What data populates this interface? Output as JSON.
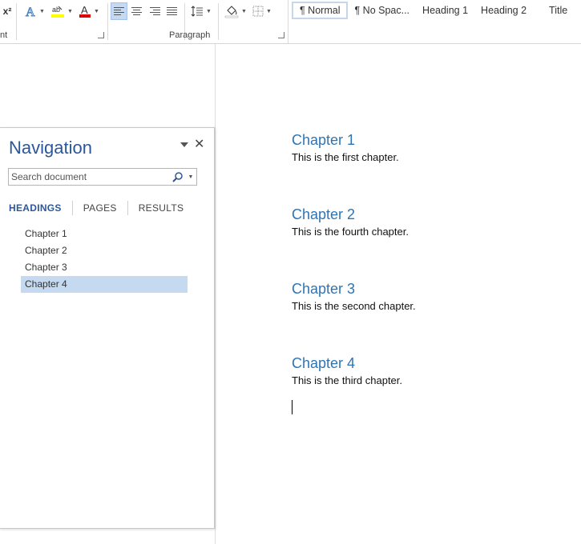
{
  "ribbon": {
    "font_group_label": "nt",
    "paragraph_group_label": "Paragraph",
    "superscript_label": "x²",
    "styles": [
      {
        "label": "¶ Normal",
        "active": true
      },
      {
        "label": "¶ No Spac...",
        "active": false
      },
      {
        "label": "Heading 1",
        "active": false
      },
      {
        "label": "Heading 2",
        "active": false
      },
      {
        "label": "Title",
        "active": false
      }
    ]
  },
  "navigation": {
    "title": "Navigation",
    "search_placeholder": "Search document",
    "tabs": [
      "HEADINGS",
      "PAGES",
      "RESULTS"
    ],
    "active_tab": "HEADINGS",
    "headings": [
      "Chapter 1",
      "Chapter 2",
      "Chapter 3",
      "Chapter 4"
    ],
    "selected_heading": "Chapter 4"
  },
  "document": {
    "chapters": [
      {
        "heading": "Chapter 1",
        "text": "This is the first chapter."
      },
      {
        "heading": "Chapter 2",
        "text": "This is the fourth chapter."
      },
      {
        "heading": "Chapter 3",
        "text": "This is the second chapter."
      },
      {
        "heading": "Chapter 4",
        "text": "This is the third chapter."
      }
    ]
  },
  "colors": {
    "accent": "#2b579a",
    "heading": "#2e74b5",
    "selection": "#c5d9f1"
  }
}
